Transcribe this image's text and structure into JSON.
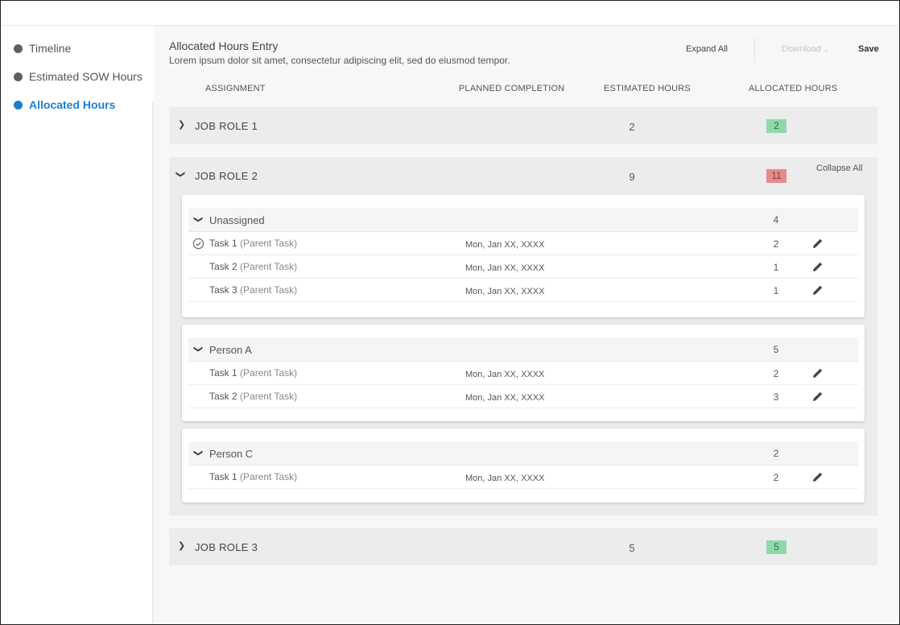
{
  "sidebar": {
    "items": [
      {
        "label": "Timeline",
        "active": false
      },
      {
        "label": "Estimated SOW Hours",
        "active": false
      },
      {
        "label": "Allocated Hours",
        "active": true
      }
    ]
  },
  "header": {
    "title": "Allocated Hours Entry",
    "subtitle": "Lorem ipsum dolor sit amet, consectetur adipiscing elit, sed do eiusmod tempor.",
    "expand_all": "Expand All",
    "download": "Download",
    "save": "Save"
  },
  "columns": {
    "assignment": "ASSIGNMENT",
    "planned": "PLANNED COMPLETION",
    "estimated": "ESTIMATED HOURS",
    "allocated": "ALLOCATED HOURS"
  },
  "roles": [
    {
      "name": "JOB ROLE 1",
      "estimated": "2",
      "allocated": "2",
      "status_color": "#8fd8a9"
    },
    {
      "name": "JOB ROLE 2",
      "estimated": "9",
      "allocated": "11",
      "status_color": "#e58a8c",
      "collapse_all": "Collapse All",
      "groups": [
        {
          "name": "Unassigned",
          "total": "4",
          "tasks": [
            {
              "name": "Task 1",
              "parent": "(Parent Task)",
              "date": "Mon, Jan XX, XXXX",
              "hours": "2"
            },
            {
              "name": "Task 2",
              "parent": "(Parent Task)",
              "date": "Mon, Jan XX, XXXX",
              "hours": "1"
            },
            {
              "name": "Task 3",
              "parent": "(Parent Task)",
              "date": "Mon, Jan XX, XXXX",
              "hours": "1"
            }
          ]
        },
        {
          "name": "Person A",
          "total": "5",
          "tasks": [
            {
              "name": "Task 1",
              "parent": "(Parent Task)",
              "date": "Mon, Jan XX, XXXX",
              "hours": "2"
            },
            {
              "name": "Task 2",
              "parent": "(Parent Task)",
              "date": "Mon, Jan XX, XXXX",
              "hours": "3"
            }
          ]
        },
        {
          "name": "Person C",
          "total": "2",
          "tasks": [
            {
              "name": "Task 1",
              "parent": "(Parent Task)",
              "date": "Mon, Jan XX, XXXX",
              "hours": "2"
            }
          ]
        }
      ]
    },
    {
      "name": "JOB ROLE 3",
      "estimated": "5",
      "allocated": "5",
      "status_color": "#8fd8a9"
    }
  ]
}
